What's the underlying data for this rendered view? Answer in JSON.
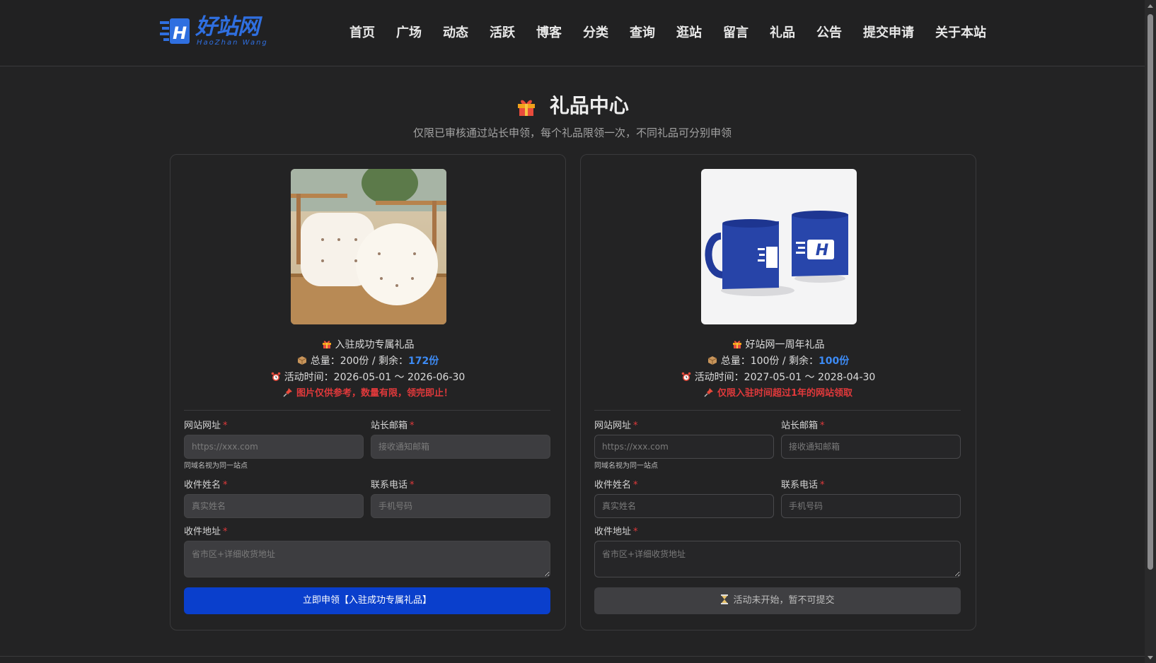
{
  "header": {
    "logo_cn": "好站网",
    "logo_en": "HaoZhan Wang",
    "nav": [
      "首页",
      "广场",
      "动态",
      "活跃",
      "博客",
      "分类",
      "查询",
      "逛站",
      "留言",
      "礼品",
      "公告",
      "提交申请",
      "关于本站"
    ]
  },
  "page": {
    "title": "礼品中心",
    "subtitle": "仅限已审核通过站长申领，每个礼品限领一次，不同礼品可分别申领"
  },
  "gifts": [
    {
      "name": "入驻成功专属礼品",
      "total_label": "总量：200份 / 剩余：",
      "remaining": "172份",
      "period": "活动时间：2026-05-01 ～ 2026-06-30",
      "note": "图片仅供参考，数量有限，领完即止！",
      "form": {
        "site_url_label": "网站网址",
        "site_url_placeholder": "https://xxx.com",
        "site_url_hint": "同域名视为同一站点",
        "email_label": "站长邮箱",
        "email_placeholder": "接收通知邮箱",
        "name_label": "收件姓名",
        "name_placeholder": "真实姓名",
        "phone_label": "联系电话",
        "phone_placeholder": "手机号码",
        "address_label": "收件地址",
        "address_placeholder": "省市区+详细收货地址"
      },
      "button": "立即申领【入驻成功专属礼品】"
    },
    {
      "name": "好站网一周年礼品",
      "total_label": "总量：100份 / 剩余：",
      "remaining": "100份",
      "period": "活动时间：2027-05-01 ～ 2028-04-30",
      "note": "仅限入驻时间超过1年的网站领取",
      "form": {
        "site_url_label": "网站网址",
        "site_url_placeholder": "https://xxx.com",
        "site_url_hint": "同域名视为同一站点",
        "email_label": "站长邮箱",
        "email_placeholder": "接收通知邮箱",
        "name_label": "收件姓名",
        "name_placeholder": "真实姓名",
        "phone_label": "联系电话",
        "phone_placeholder": "手机号码",
        "address_label": "收件地址",
        "address_placeholder": "省市区+详细收货地址"
      },
      "button": "活动未开始，暂不可提交"
    }
  ],
  "colors": {
    "accent": "#0a3fcc",
    "remaining": "#3d8bf5",
    "warning": "#e0393b",
    "logo": "#2f6fe0"
  }
}
